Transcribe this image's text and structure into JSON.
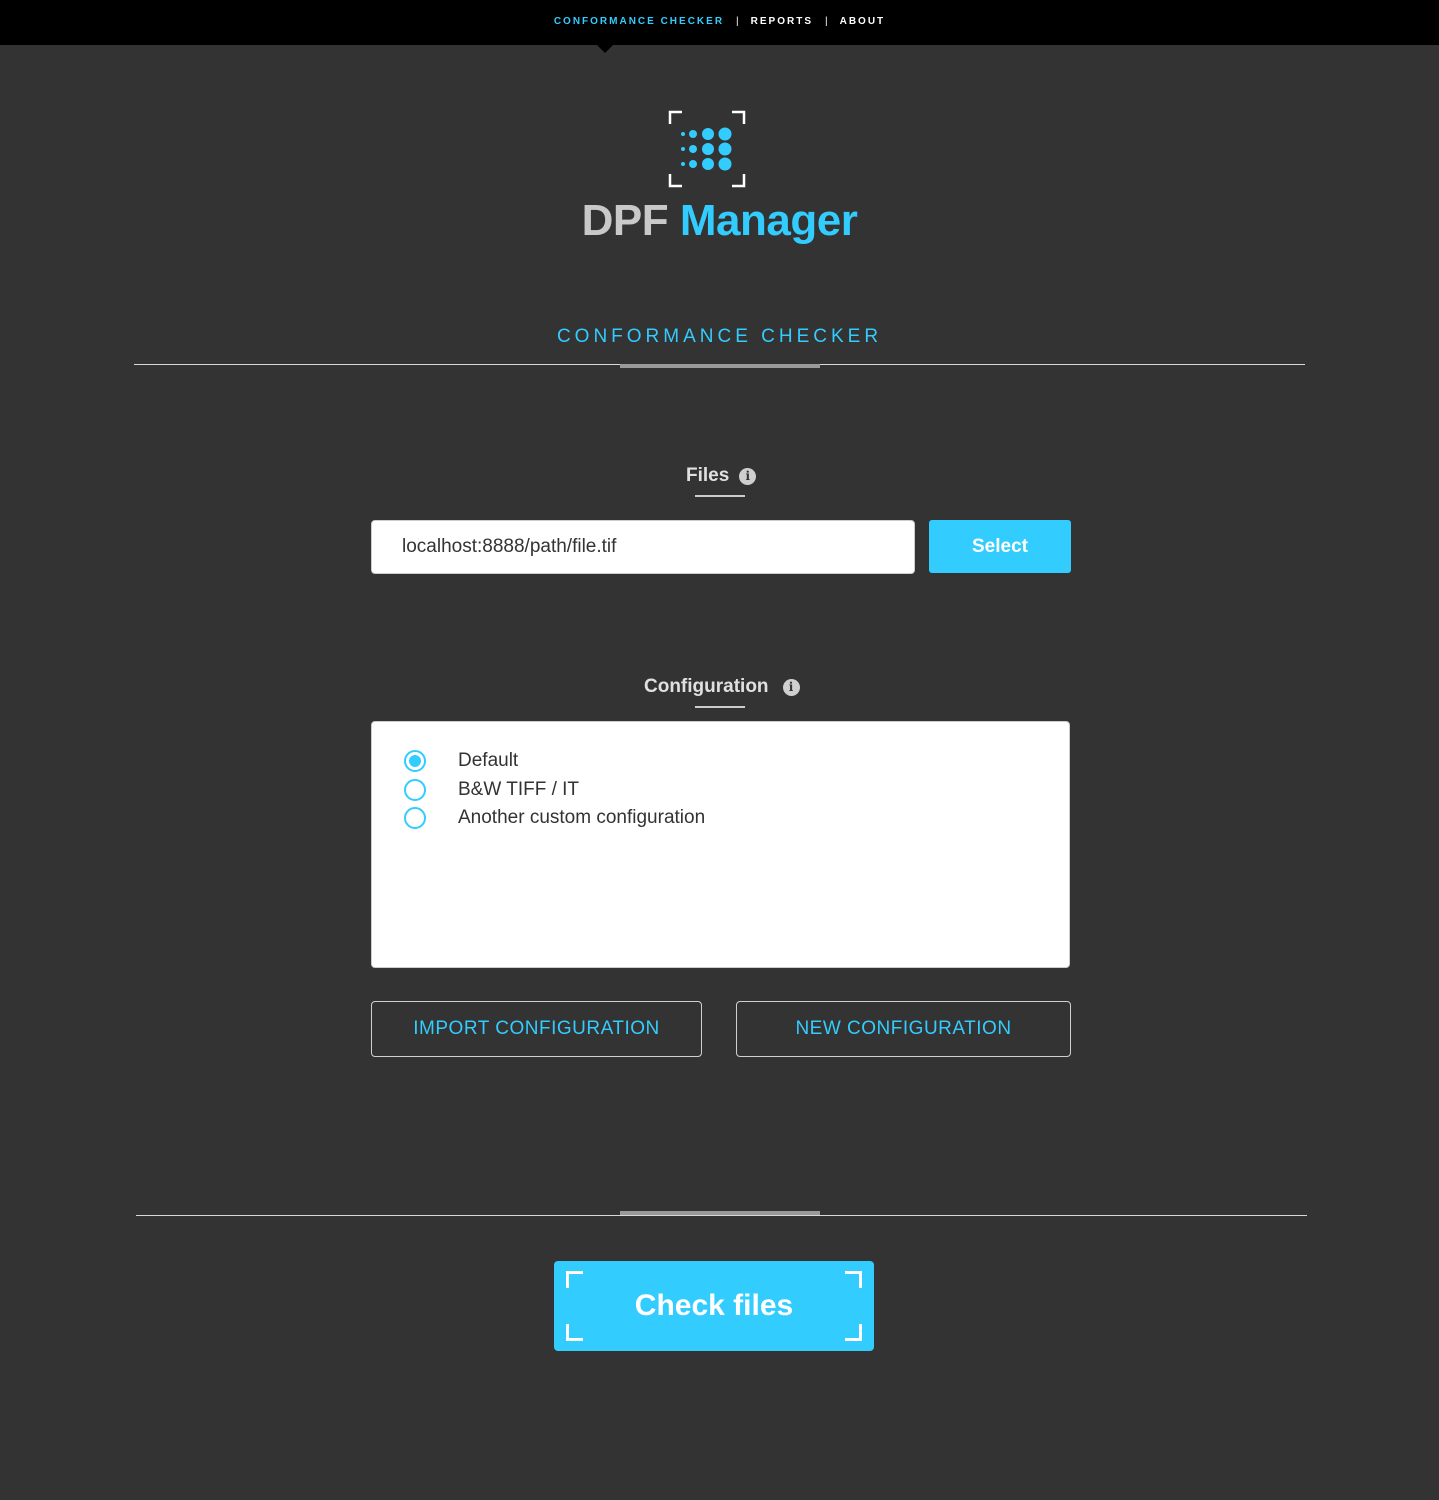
{
  "nav": {
    "items": [
      {
        "label": "CONFORMANCE CHECKER",
        "active": true
      },
      {
        "label": "REPORTS",
        "active": false
      },
      {
        "label": "ABOUT",
        "active": false
      }
    ]
  },
  "brand": {
    "part1": "DPF",
    "part2": "Manager",
    "logo_icon": "dot-grid-logo-icon"
  },
  "section": {
    "title": "CONFORMANCE CHECKER"
  },
  "files": {
    "label": "Files",
    "info_icon": "info-icon",
    "input_value": "localhost:8888/path/file.tif",
    "select_label": "Select"
  },
  "configuration": {
    "label": "Configuration",
    "info_icon": "info-icon",
    "options": [
      {
        "label": "Default",
        "checked": true
      },
      {
        "label": "B&W TIFF / IT",
        "checked": false
      },
      {
        "label": "Another custom configuration",
        "checked": false
      }
    ],
    "import_label": "IMPORT CONFIGURATION",
    "new_label": "NEW CONFIGURATION"
  },
  "actions": {
    "check_label": "Check files"
  },
  "colors": {
    "accent": "#33ccff",
    "background": "#333333",
    "topbar": "#000000"
  }
}
